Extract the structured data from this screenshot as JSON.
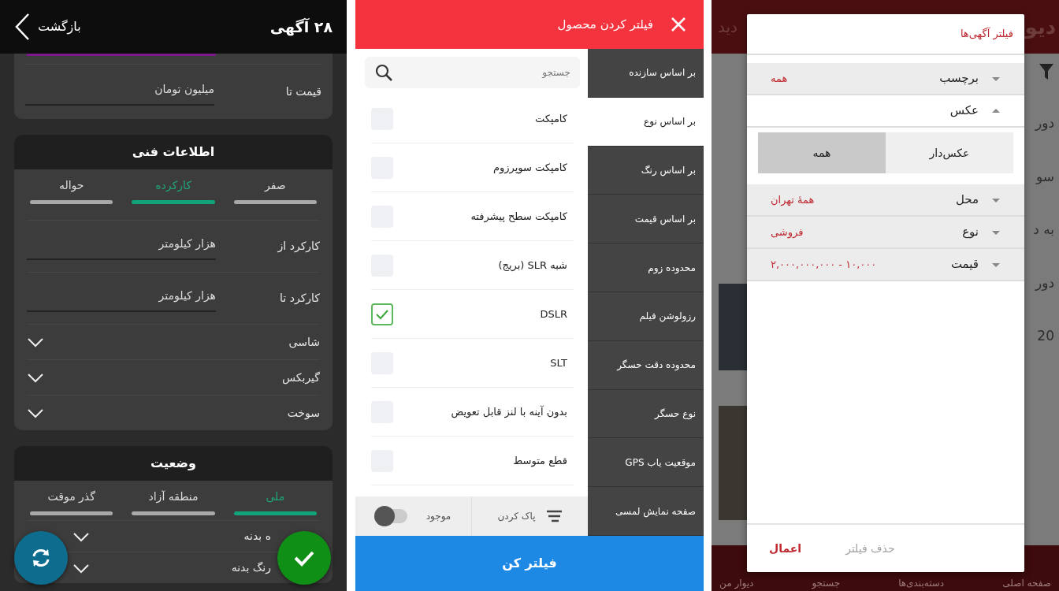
{
  "car_filter": {
    "header": {
      "title": "۲۸ آگهی",
      "back_label": "بازگشت"
    },
    "price_card": {
      "label": "قیمت تا",
      "unit": "میلیون تومان"
    },
    "sections": [
      {
        "title": "اطلاعات فنی",
        "tabs": [
          {
            "label": "صفر",
            "selected": false
          },
          {
            "label": "کارکرده",
            "selected": true
          },
          {
            "label": "حواله",
            "selected": false
          }
        ],
        "rows": [
          {
            "kind": "range",
            "label": "کارکرد از",
            "unit": "هزار کیلومتر"
          },
          {
            "kind": "range",
            "label": "کارکرد تا",
            "unit": "هزار کیلومتر"
          },
          {
            "kind": "dropdown",
            "label": "شاسی"
          },
          {
            "kind": "dropdown",
            "label": "گیربکس"
          },
          {
            "kind": "dropdown",
            "label": "سوخت"
          }
        ]
      },
      {
        "title": "وضعیت",
        "tabs": [
          {
            "label": "ملی",
            "selected": true
          },
          {
            "label": "منطقه آزاد",
            "selected": false
          },
          {
            "label": "گذر موقت",
            "selected": false
          }
        ],
        "rows": [
          {
            "kind": "dropdown",
            "label": "ه بدنه"
          },
          {
            "kind": "dropdown",
            "label": "رنگ بدنه"
          }
        ]
      }
    ]
  },
  "product_filter": {
    "title": "فیلتر کردن محصول",
    "search": {
      "placeholder": "جستجو"
    },
    "categories": [
      {
        "label": "بر اساس سازنده",
        "selected": false
      },
      {
        "label": "بر اساس نوع",
        "selected": true
      },
      {
        "label": "بر اساس رنگ",
        "selected": false
      },
      {
        "label": "بر اساس قیمت",
        "selected": false
      },
      {
        "label": "محدوده زوم",
        "selected": false
      },
      {
        "label": "رزولوشن فیلم",
        "selected": false
      },
      {
        "label": "محدوده دقت حسگر",
        "selected": false
      },
      {
        "label": "نوع حسگر",
        "selected": false
      },
      {
        "label": "موقعیت یاب GPS",
        "selected": false
      },
      {
        "label": "صفحه نمایش لمسی",
        "selected": false
      }
    ],
    "options": [
      {
        "label": "کامپکت",
        "checked": false
      },
      {
        "label": "کامپکت سوپرزوم",
        "checked": false
      },
      {
        "label": "کامپکت سطح پیشرفته",
        "checked": false
      },
      {
        "label": "شبه SLR (بریج)",
        "checked": false
      },
      {
        "label": "DSLR",
        "checked": true
      },
      {
        "label": "SLT",
        "checked": false
      },
      {
        "label": "بدون آینه با لنز قابل تعویض",
        "checked": false
      },
      {
        "label": "قطع متوسط",
        "checked": false
      }
    ],
    "clear_label": "پاک کردن",
    "stock": {
      "label": "موجود",
      "on": false
    },
    "apply_label": "فیلتر کن"
  },
  "ads_filter": {
    "background": {
      "logo": "دیو",
      "header_link": "دید",
      "strip_texts": [
        "دور",
        "سو",
        "به د",
        "دور",
        "20"
      ],
      "nav": [
        "صفحه اصلی",
        "دسته‌بندی‌ها",
        "جستجو",
        "دیوار من"
      ]
    },
    "dialog": {
      "title": "فیلتر آگهی‌ها",
      "filters": [
        {
          "kind": "select",
          "label": "برچسب",
          "value": "همه",
          "expanded": false
        },
        {
          "kind": "segmented",
          "label": "عکس",
          "expanded": true,
          "options": [
            {
              "label": "عکس‌دار",
              "selected": false
            },
            {
              "label": "همه",
              "selected": true
            }
          ]
        },
        {
          "kind": "select",
          "label": "محل",
          "value": "همهٔ تهران",
          "expanded": false
        },
        {
          "kind": "select",
          "label": "نوع",
          "value": "فروشی",
          "expanded": false
        },
        {
          "kind": "select",
          "label": "قیمت",
          "value": "۱۰,۰۰۰ - ۲,۰۰۰,۰۰۰,۰۰۰",
          "expanded": false
        }
      ],
      "buttons": [
        {
          "label": "حذف فیلتر",
          "disabled": true
        },
        {
          "label": "اعمال",
          "disabled": false
        }
      ]
    }
  }
}
